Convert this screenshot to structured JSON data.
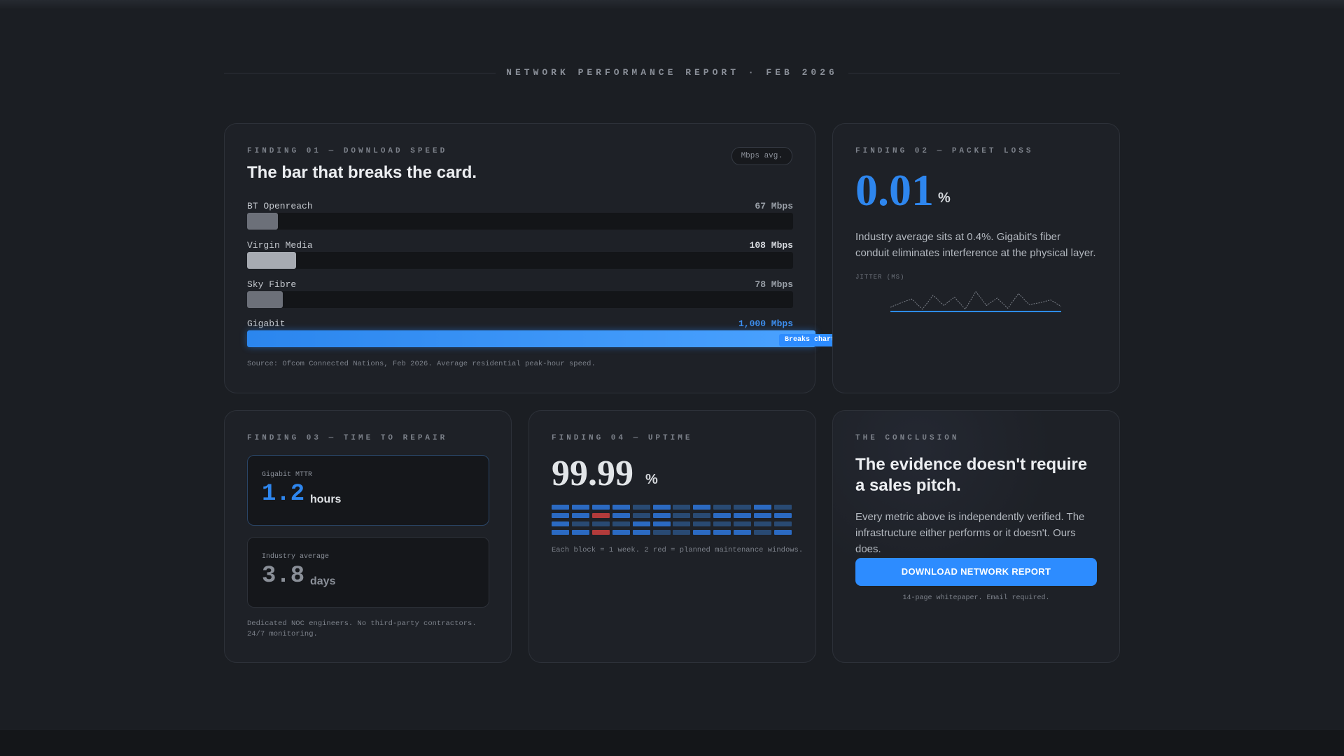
{
  "header": {
    "title": "NETWORK PERFORMANCE REPORT · FEB 2026"
  },
  "colors": {
    "accent": "#2d8cff",
    "maintenance": "#b23b3b",
    "background": "#1b1e23"
  },
  "finding1": {
    "eyebrow": "FINDING 01 — DOWNLOAD SPEED",
    "unit_pill": "Mbps avg.",
    "title": "The bar that breaks the card.",
    "bars": [
      {
        "name": "BT Openreach",
        "value_label": "67 Mbps",
        "value": 67,
        "style": "gray"
      },
      {
        "name": "Virgin Media",
        "value_label": "108 Mbps",
        "value": 108,
        "style": "light"
      },
      {
        "name": "Sky Fibre",
        "value_label": "78 Mbps",
        "value": 78,
        "style": "gray"
      },
      {
        "name": "Gigabit",
        "value_label": "1,000 Mbps",
        "value": 1000,
        "style": "blue"
      }
    ],
    "breaks_label": "Breaks chart →",
    "source": "Source: Ofcom Connected Nations, Feb 2026. Average residential peak-hour speed."
  },
  "finding2": {
    "eyebrow": "FINDING 02 — PACKET LOSS",
    "value": "0.01",
    "unit": "%",
    "description": "Industry average sits at 0.4%. Gigabit's fiber conduit eliminates interference at the physical layer.",
    "jitter_label": "JITTER (MS)",
    "jitter_industry": [
      3,
      8,
      12,
      1,
      16,
      5,
      14,
      1,
      20,
      5,
      13,
      2,
      18,
      6,
      8,
      11,
      4
    ]
  },
  "finding3": {
    "eyebrow": "FINDING 03 — TIME TO REPAIR",
    "gigabit": {
      "label": "Gigabit MTTR",
      "value": "1.2",
      "unit": "hours"
    },
    "industry": {
      "label": "Industry average",
      "value": "3.8",
      "unit": "days"
    },
    "note": "Dedicated NOC engineers. No third-party contractors. 24/7 monitoring."
  },
  "finding4": {
    "eyebrow": "FINDING 04 — UPTIME",
    "value": "99.99",
    "unit": "%",
    "weeks": [
      [
        2,
        2,
        2,
        2,
        1,
        2,
        1,
        2,
        1,
        1,
        2,
        1
      ],
      [
        2,
        2,
        3,
        2,
        1,
        2,
        1,
        1,
        2,
        2,
        2,
        2
      ],
      [
        2,
        1,
        1,
        1,
        2,
        2,
        1,
        1,
        1,
        1,
        1,
        1
      ],
      [
        2,
        2,
        3,
        2,
        2,
        1,
        1,
        2,
        2,
        2,
        1,
        2
      ]
    ],
    "note": "Each block = 1 week. 2 red = planned maintenance windows."
  },
  "conclusion": {
    "eyebrow": "THE CONCLUSION",
    "title": "The evidence doesn't require a sales pitch.",
    "body": "Every metric above is independently verified. The infrastructure either performs or it doesn't. Ours does.",
    "cta": "DOWNLOAD NETWORK REPORT",
    "cta_note": "14-page whitepaper. Email required."
  }
}
